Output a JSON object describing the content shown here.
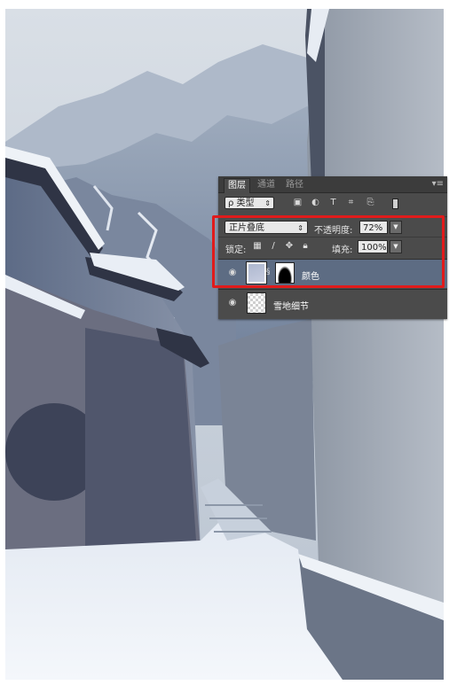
{
  "panel": {
    "tabs": [
      {
        "label": "图层",
        "active": true
      },
      {
        "label": "通道",
        "active": false
      },
      {
        "label": "路径",
        "active": false
      }
    ],
    "menu_icon": "panel-menu-icon",
    "filter": {
      "value": "类型",
      "icons": [
        "image-filter-icon",
        "adjustment-filter-icon",
        "type-filter-icon",
        "shape-filter-icon",
        "smart-object-filter-icon"
      ]
    },
    "blend_mode": "正片叠底",
    "opacity_label": "不透明度:",
    "opacity_value": "72%",
    "lock_label": "锁定:",
    "lock_icons": [
      "lock-transparent-icon",
      "lock-paint-icon",
      "lock-move-icon",
      "lock-all-icon"
    ],
    "fill_label": "填充:",
    "fill_value": "100%",
    "layers": [
      {
        "name": "颜色",
        "selected": true,
        "visible": true,
        "has_mask": true
      },
      {
        "name": "雪地细节",
        "selected": false,
        "visible": true,
        "has_mask": false
      }
    ]
  },
  "colors": {
    "panel_bg": "#4b4b4b",
    "selected_layer": "#5d6c83",
    "highlight": "#e11b1b"
  }
}
